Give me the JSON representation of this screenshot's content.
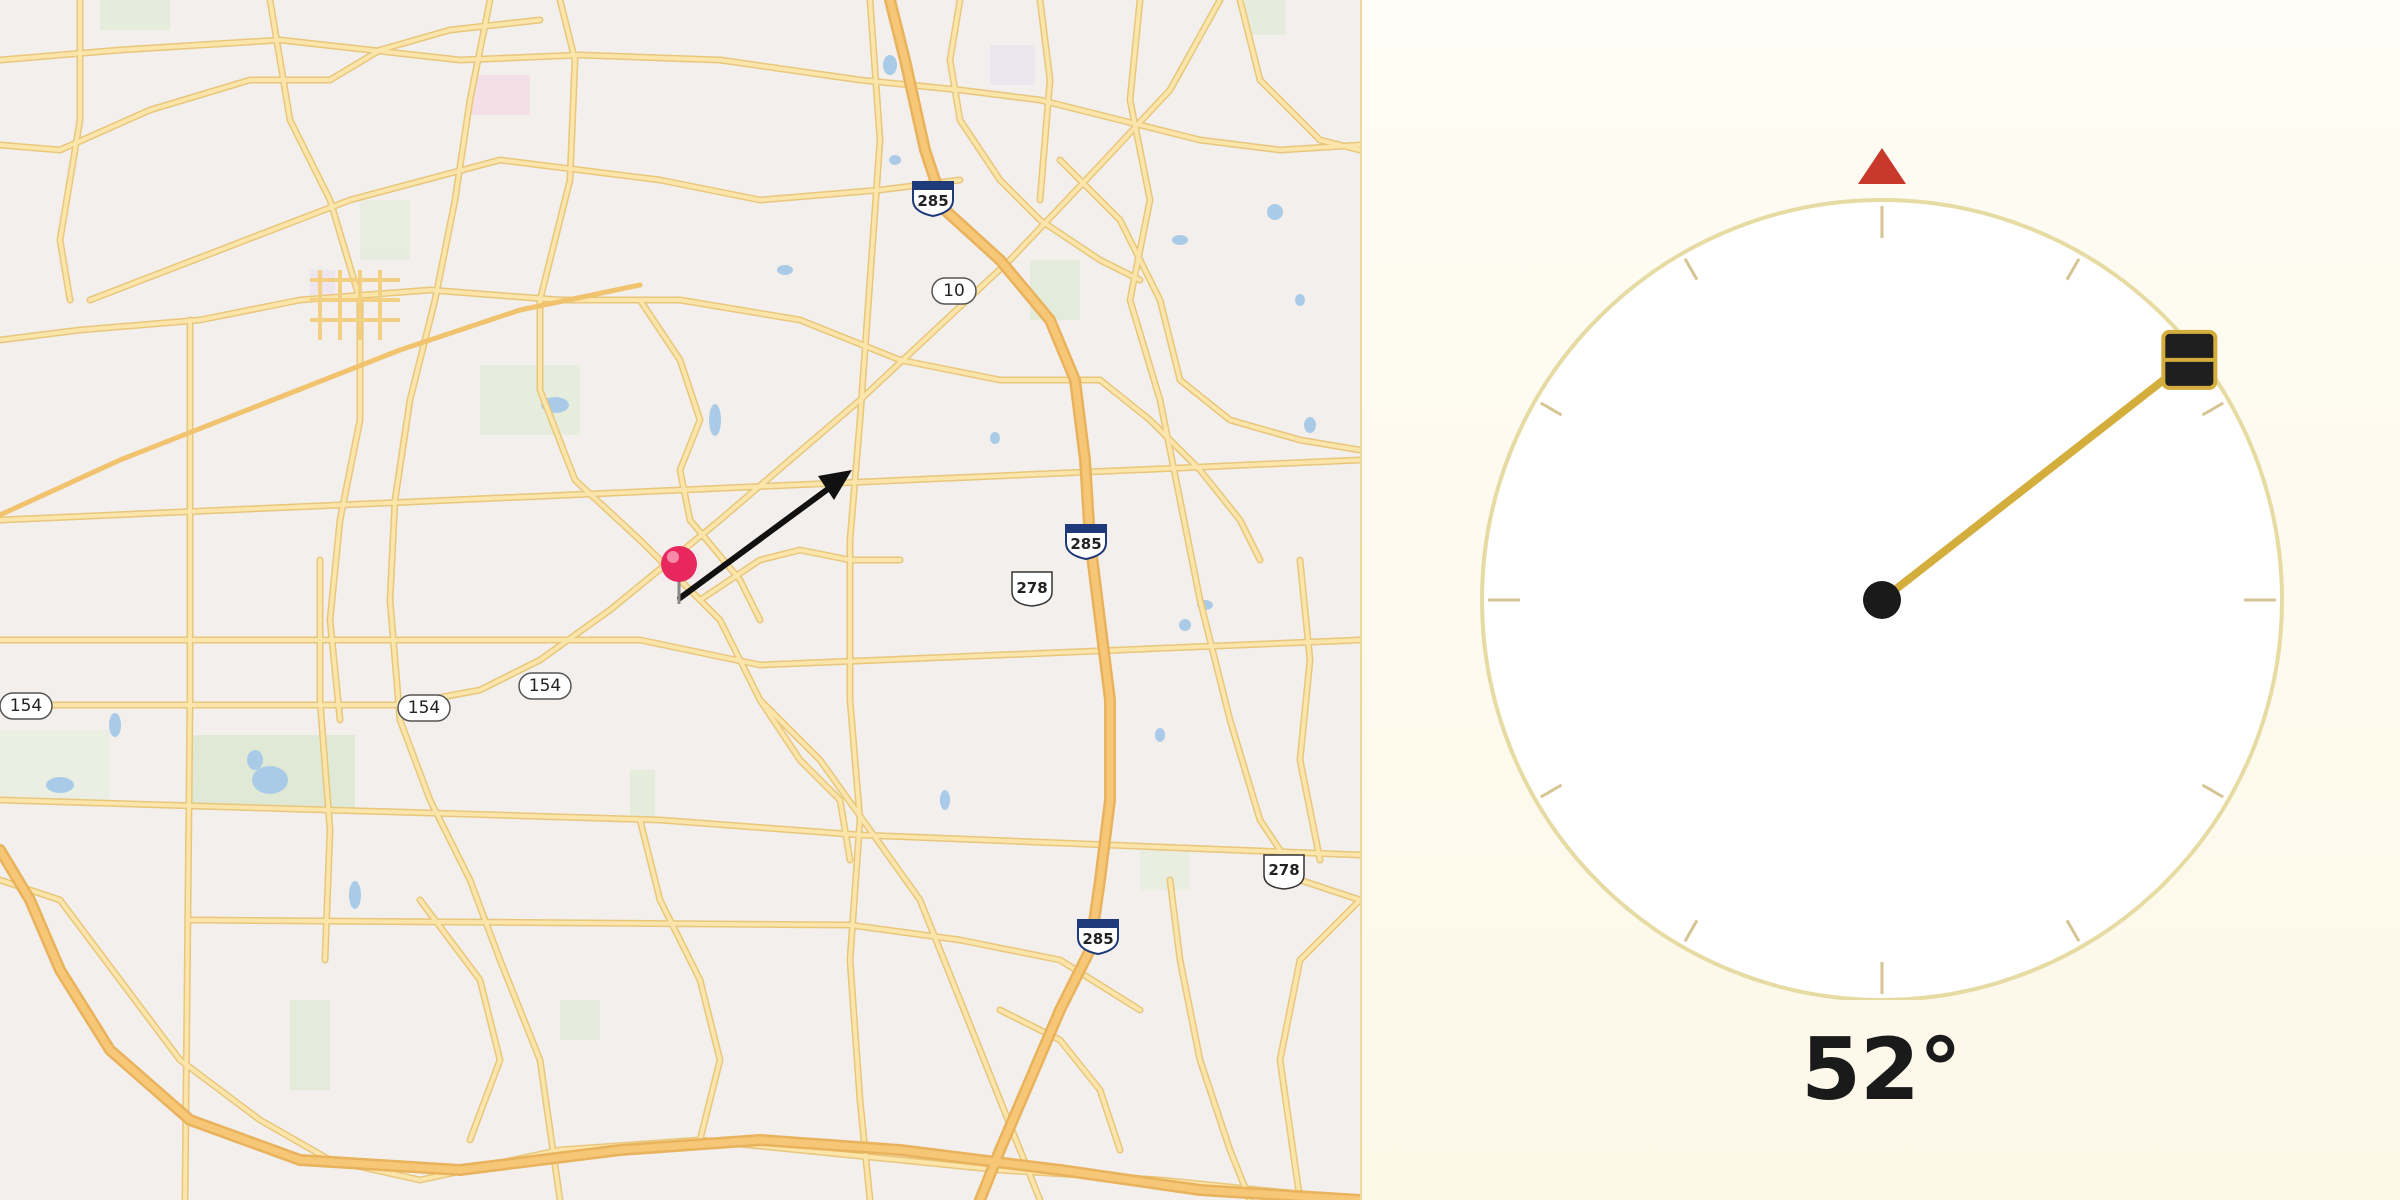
{
  "map": {
    "route_shields": [
      {
        "kind": "state",
        "label": "154"
      },
      {
        "kind": "state",
        "label": "154"
      },
      {
        "kind": "state",
        "label": "154"
      },
      {
        "kind": "state",
        "label": "10"
      },
      {
        "kind": "us",
        "label": "278"
      },
      {
        "kind": "us",
        "label": "278"
      },
      {
        "kind": "interstate",
        "label": "285"
      },
      {
        "kind": "interstate",
        "label": "285"
      },
      {
        "kind": "interstate",
        "label": "285"
      }
    ],
    "pin": {
      "icon": "map-pin-icon",
      "color": "#e8275f"
    },
    "direction_arrow": {
      "icon": "direction-arrow-icon",
      "color": "#111111"
    }
  },
  "compass": {
    "heading_degrees": 52,
    "heading_text": "52°",
    "north_marker": {
      "icon": "north-triangle-icon",
      "color": "#c8392b"
    },
    "needle_color": "#d3ae3c",
    "ring_color": "#e6dba3",
    "tick_count": 12
  }
}
